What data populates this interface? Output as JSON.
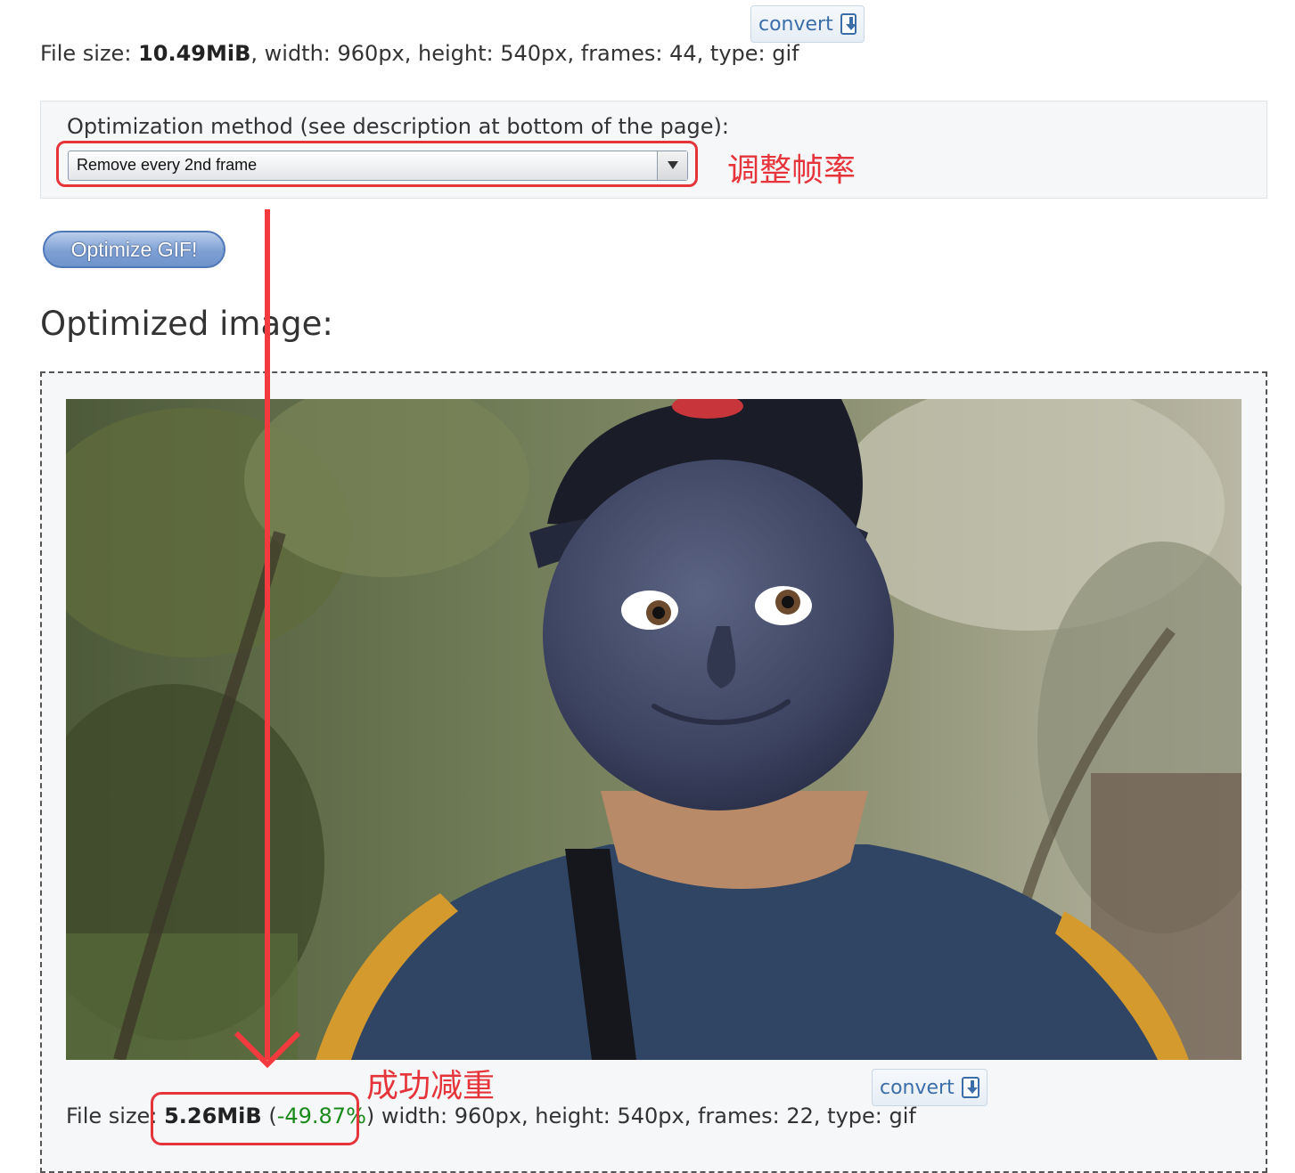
{
  "original": {
    "file_size_label": "File size:",
    "file_size_value": "10.49MiB",
    "details": ", width: 960px, height: 540px, frames: 44, type: gif",
    "convert_label": "convert"
  },
  "options": {
    "method_label": "Optimization method (see description at bottom of the page):",
    "selected_method": "Remove every 2nd frame",
    "annotation": "调整帧率"
  },
  "optimize_button": "Optimize GIF!",
  "result": {
    "heading": "Optimized image:",
    "file_size_label": "File size:",
    "file_size_value": "5.26MiB",
    "open_paren": "(",
    "change": "-49.87%",
    "close_paren": ")",
    "details": " width: 960px, height: 540px, frames: 22, type: gif",
    "convert_label": "convert",
    "annotation": "成功减重",
    "change_color": "#1a8a1a"
  },
  "annotation_color": "#e6343b"
}
